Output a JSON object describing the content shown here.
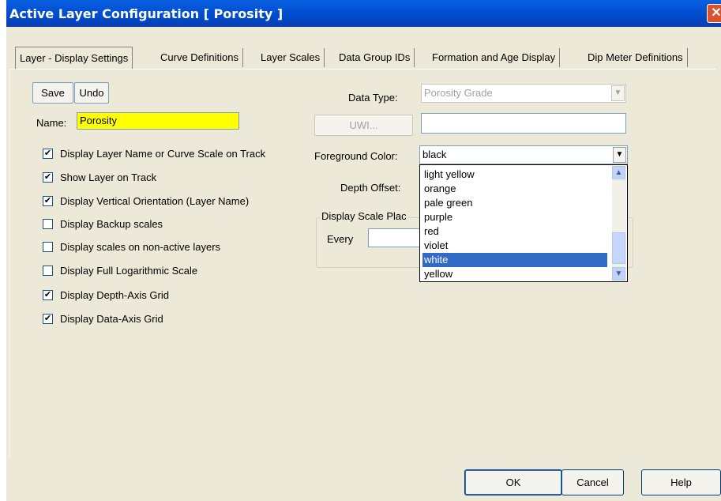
{
  "window": {
    "title": "Active Layer Configuration   [ Porosity ]",
    "close_glyph": "✕"
  },
  "tabs": [
    "Layer - Display Settings",
    "Curve Definitions",
    "Layer Scales",
    "Data Group IDs",
    "Formation and Age Display",
    "Dip Meter Definitions"
  ],
  "left": {
    "save_label": "Save",
    "undo_label": "Undo",
    "name_label": "Name:",
    "name_value": "Porosity",
    "checkboxes": [
      {
        "label": "Display Layer Name or Curve Scale on Track",
        "checked": true
      },
      {
        "label": "Show Layer on Track",
        "checked": true
      },
      {
        "label": "Display Vertical Orientation (Layer Name)",
        "checked": true
      },
      {
        "label": "Display Backup scales",
        "checked": false
      },
      {
        "label": "Display scales on non-active layers",
        "checked": false
      },
      {
        "label": "Display Full Logarithmic Scale",
        "checked": false
      },
      {
        "label": "Display Depth-Axis Grid",
        "checked": true
      },
      {
        "label": "Display Data-Axis Grid",
        "checked": true
      }
    ]
  },
  "right": {
    "data_type_label": "Data Type:",
    "data_type_value": "Porosity Grade",
    "uwi_label": "UWI...",
    "uwi_value": "",
    "fg_color_label": "Foreground Color:",
    "fg_color_value": "black",
    "depth_offset_label": "Depth Offset:",
    "group_label": "Display Scale Plac",
    "every_label": "Every"
  },
  "color_list": [
    "light yellow",
    "orange",
    "pale green",
    "purple",
    "red",
    "violet",
    "white",
    "yellow"
  ],
  "color_list_selected": "white",
  "buttons": {
    "ok": "OK",
    "cancel": "Cancel",
    "help": "Help"
  },
  "colors": {
    "title_bar": "#0454d8",
    "name_bg": "#ffff00",
    "selection": "#316ac5",
    "dialog_bg": "#ece9d8"
  }
}
